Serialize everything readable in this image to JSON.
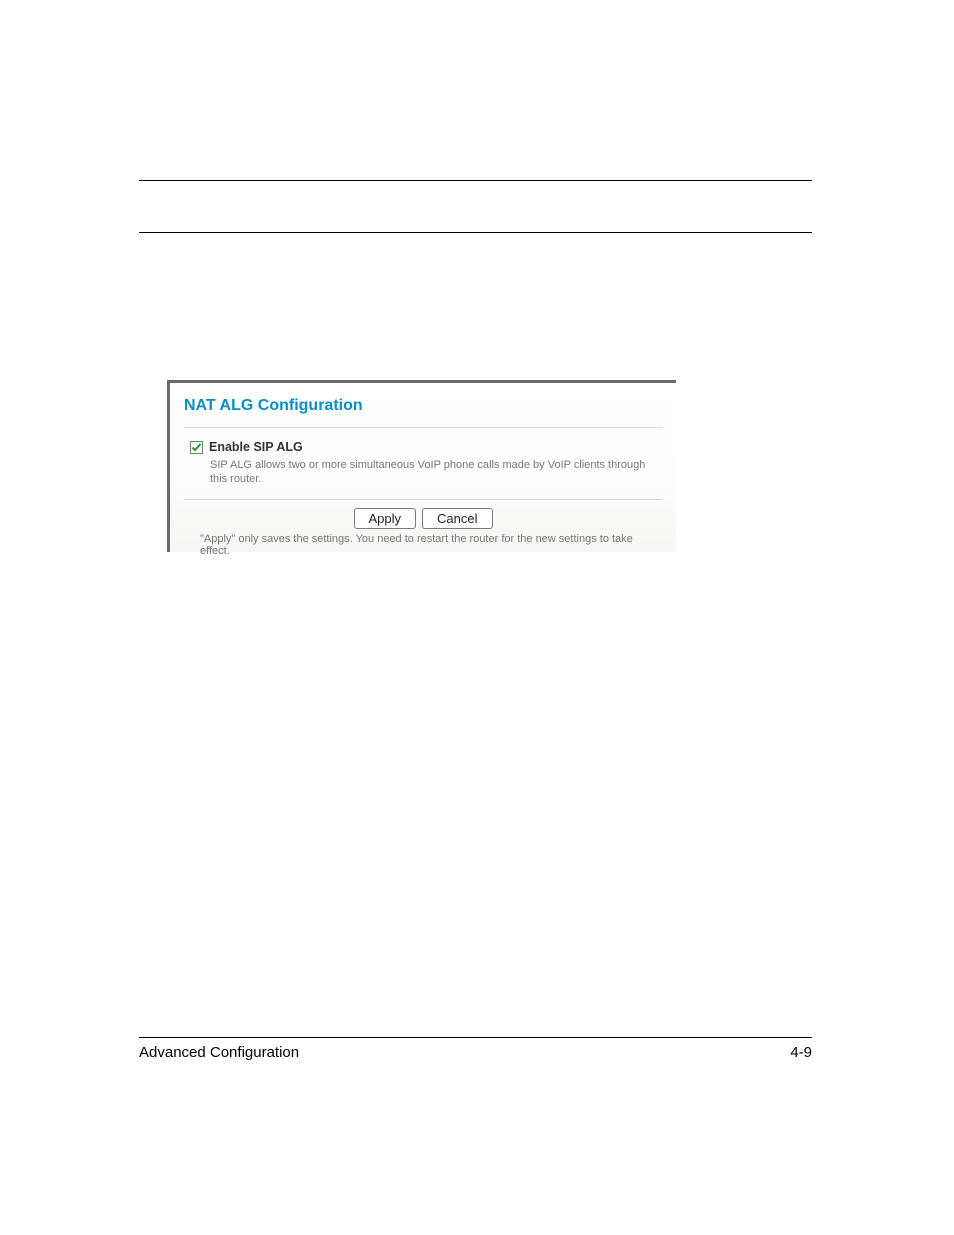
{
  "panel": {
    "title": "NAT ALG Configuration",
    "option": {
      "label": "Enable SIP ALG",
      "checked": true,
      "description": "SIP ALG allows two or more simultaneous VoIP phone calls made by VoIP clients through this router."
    },
    "buttons": {
      "apply": "Apply",
      "cancel": "Cancel"
    },
    "note": "\"Apply\" only saves the settings. You need to restart the router for the new settings to take effect."
  },
  "footer": {
    "left": "Advanced Configuration",
    "right": "4-9"
  }
}
